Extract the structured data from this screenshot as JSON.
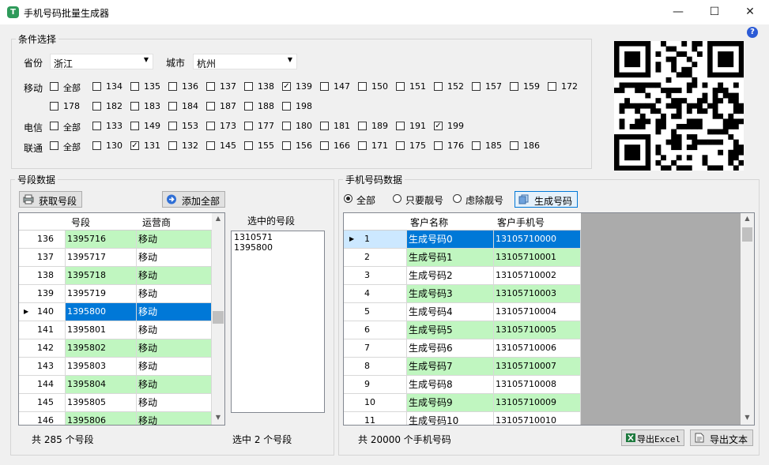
{
  "window": {
    "title": "手机号码批量生成器",
    "minimize_glyph": "—",
    "maximize_glyph": "☐",
    "close_glyph": "✕",
    "help_glyph": "?"
  },
  "conditions": {
    "legend": "条件选择",
    "province_label": "省份",
    "province_value": "浙江",
    "city_label": "城市",
    "city_value": "杭州",
    "mobile": {
      "label": "移动",
      "all_label": "全部",
      "all_checked": false,
      "items": [
        {
          "label": "134",
          "checked": false
        },
        {
          "label": "135",
          "checked": false
        },
        {
          "label": "136",
          "checked": false
        },
        {
          "label": "137",
          "checked": false
        },
        {
          "label": "138",
          "checked": false
        },
        {
          "label": "139",
          "checked": true
        },
        {
          "label": "147",
          "checked": false
        },
        {
          "label": "150",
          "checked": false
        },
        {
          "label": "151",
          "checked": false
        },
        {
          "label": "152",
          "checked": false
        },
        {
          "label": "157",
          "checked": false
        },
        {
          "label": "159",
          "checked": false
        },
        {
          "label": "172",
          "checked": false
        },
        {
          "label": "178",
          "checked": false
        },
        {
          "label": "182",
          "checked": false
        },
        {
          "label": "183",
          "checked": false
        },
        {
          "label": "184",
          "checked": false
        },
        {
          "label": "187",
          "checked": false
        },
        {
          "label": "188",
          "checked": false
        },
        {
          "label": "198",
          "checked": false
        }
      ]
    },
    "telecom": {
      "label": "电信",
      "all_label": "全部",
      "all_checked": false,
      "items": [
        {
          "label": "133",
          "checked": false
        },
        {
          "label": "149",
          "checked": false
        },
        {
          "label": "153",
          "checked": false
        },
        {
          "label": "173",
          "checked": false
        },
        {
          "label": "177",
          "checked": false
        },
        {
          "label": "180",
          "checked": false
        },
        {
          "label": "181",
          "checked": false
        },
        {
          "label": "189",
          "checked": false
        },
        {
          "label": "191",
          "checked": false
        },
        {
          "label": "199",
          "checked": true
        }
      ]
    },
    "unicom": {
      "label": "联通",
      "all_label": "全部",
      "all_checked": false,
      "items": [
        {
          "label": "130",
          "checked": false
        },
        {
          "label": "131",
          "checked": true
        },
        {
          "label": "132",
          "checked": false
        },
        {
          "label": "145",
          "checked": false
        },
        {
          "label": "155",
          "checked": false
        },
        {
          "label": "156",
          "checked": false
        },
        {
          "label": "166",
          "checked": false
        },
        {
          "label": "171",
          "checked": false
        },
        {
          "label": "175",
          "checked": false
        },
        {
          "label": "176",
          "checked": false
        },
        {
          "label": "185",
          "checked": false
        },
        {
          "label": "186",
          "checked": false
        }
      ]
    }
  },
  "segments": {
    "legend": "号段数据",
    "fetch_button": "获取号段",
    "add_all_button": "添加全部",
    "columns": [
      "号段",
      "运营商"
    ],
    "rows": [
      {
        "no": "136",
        "segment": "1395716",
        "carrier": "移动",
        "highlight": true,
        "selected": false
      },
      {
        "no": "137",
        "segment": "1395717",
        "carrier": "移动",
        "highlight": false,
        "selected": false
      },
      {
        "no": "138",
        "segment": "1395718",
        "carrier": "移动",
        "highlight": true,
        "selected": false
      },
      {
        "no": "139",
        "segment": "1395719",
        "carrier": "移动",
        "highlight": false,
        "selected": false
      },
      {
        "no": "140",
        "segment": "1395800",
        "carrier": "移动",
        "highlight": false,
        "selected": true
      },
      {
        "no": "141",
        "segment": "1395801",
        "carrier": "移动",
        "highlight": false,
        "selected": false
      },
      {
        "no": "142",
        "segment": "1395802",
        "carrier": "移动",
        "highlight": true,
        "selected": false
      },
      {
        "no": "143",
        "segment": "1395803",
        "carrier": "移动",
        "highlight": false,
        "selected": false
      },
      {
        "no": "144",
        "segment": "1395804",
        "carrier": "移动",
        "highlight": true,
        "selected": false
      },
      {
        "no": "145",
        "segment": "1395805",
        "carrier": "移动",
        "highlight": false,
        "selected": false
      },
      {
        "no": "146",
        "segment": "1395806",
        "carrier": "移动",
        "highlight": true,
        "selected": false
      }
    ],
    "total_text": "共 285 个号段",
    "selected_title": "选中的号段",
    "selected_items": [
      "1310571",
      "1395800"
    ],
    "selected_count_text": "选中 2 个号段"
  },
  "phones": {
    "legend": "手机号码数据",
    "radios": [
      {
        "label": "全部",
        "checked": true
      },
      {
        "label": "只要靓号",
        "checked": false
      },
      {
        "label": "虑除靓号",
        "checked": false
      }
    ],
    "generate_button": "生成号码",
    "columns": [
      "客户名称",
      "客户手机号"
    ],
    "rows": [
      {
        "no": "1",
        "name": "生成号码0",
        "phone": "13105710000",
        "highlight": true,
        "selected": true
      },
      {
        "no": "2",
        "name": "生成号码1",
        "phone": "13105710001",
        "highlight": true,
        "selected": false
      },
      {
        "no": "3",
        "name": "生成号码2",
        "phone": "13105710002",
        "highlight": false,
        "selected": false
      },
      {
        "no": "4",
        "name": "生成号码3",
        "phone": "13105710003",
        "highlight": true,
        "selected": false
      },
      {
        "no": "5",
        "name": "生成号码4",
        "phone": "13105710004",
        "highlight": false,
        "selected": false
      },
      {
        "no": "6",
        "name": "生成号码5",
        "phone": "13105710005",
        "highlight": true,
        "selected": false
      },
      {
        "no": "7",
        "name": "生成号码6",
        "phone": "13105710006",
        "highlight": false,
        "selected": false
      },
      {
        "no": "8",
        "name": "生成号码7",
        "phone": "13105710007",
        "highlight": true,
        "selected": false
      },
      {
        "no": "9",
        "name": "生成号码8",
        "phone": "13105710008",
        "highlight": false,
        "selected": false
      },
      {
        "no": "10",
        "name": "生成号码9",
        "phone": "13105710009",
        "highlight": true,
        "selected": false
      },
      {
        "no": "11",
        "name": "生成号码10",
        "phone": "13105710010",
        "highlight": false,
        "selected": false
      }
    ],
    "total_text": "共 20000 个手机号码",
    "export_excel_button": "导出Excel",
    "export_text_button": "导出文本"
  },
  "colors": {
    "row_highlight": "#c0f6c0",
    "row_selected": "#0078d7",
    "row_header_selected": "#cce8ff",
    "grid_background": "#ababab"
  }
}
